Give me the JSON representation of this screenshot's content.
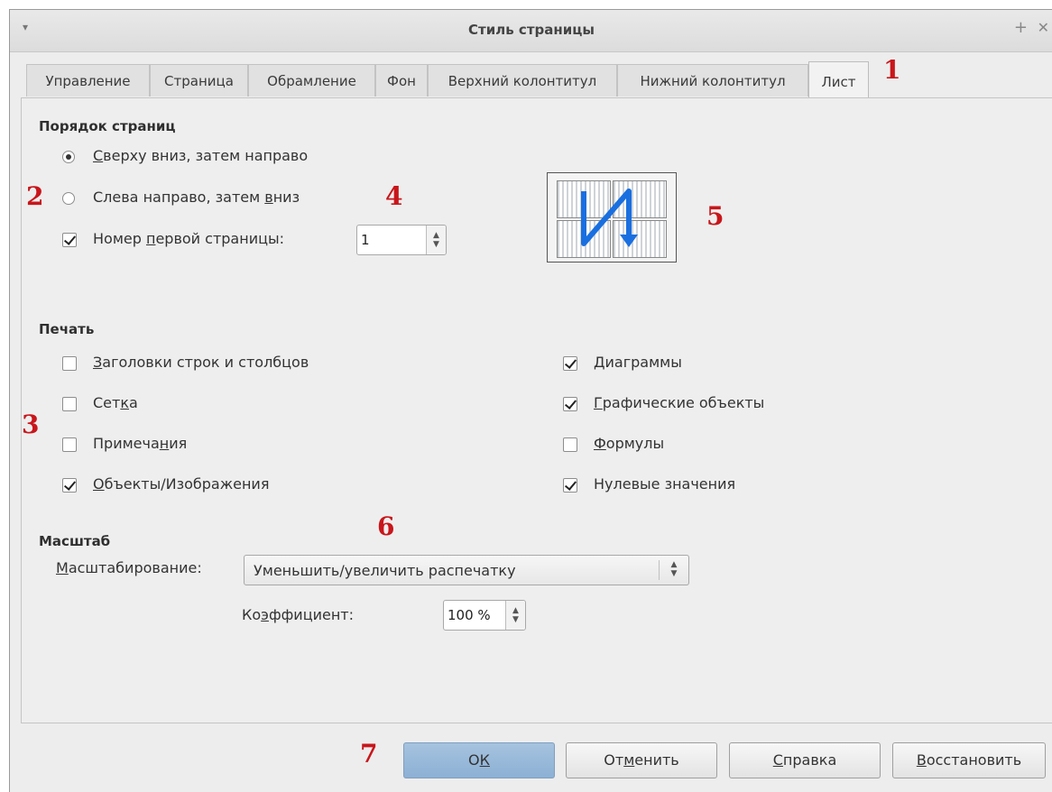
{
  "window": {
    "title": "Стиль страницы",
    "menu_glyph": "▾",
    "plus_glyph": "+",
    "close_glyph": "✕"
  },
  "tabs": [
    {
      "label": "Управление"
    },
    {
      "label": "Страница"
    },
    {
      "label": "Обрамление"
    },
    {
      "label": "Фон"
    },
    {
      "label": "Верхний колонтитул"
    },
    {
      "label": "Нижний колонтитул"
    },
    {
      "label": "Лист"
    }
  ],
  "active_tab": "Лист",
  "page_order": {
    "heading": "Порядок страниц",
    "option1": {
      "pre": "",
      "u": "С",
      "post": "верху вниз, затем направо",
      "selected": true
    },
    "option2": {
      "pre": "Слева направо, затем ",
      "u": "в",
      "post": "низ",
      "selected": false
    },
    "first_page": {
      "pre": "Номер ",
      "u": "п",
      "post": "ервой страницы:",
      "checked": true,
      "value": "1"
    }
  },
  "print": {
    "heading": "Печать",
    "items": [
      {
        "pre": "",
        "u": "З",
        "post": "аголовки строк и столбцов",
        "checked": false
      },
      {
        "pre": "Сет",
        "u": "к",
        "post": "а",
        "checked": false
      },
      {
        "pre": "Примеча",
        "u": "н",
        "post": "ия",
        "checked": false
      },
      {
        "pre": "",
        "u": "О",
        "post": "бъекты/Изображения",
        "checked": true
      },
      {
        "pre": "",
        "u": "Д",
        "post": "иаграммы",
        "checked": true
      },
      {
        "pre": "",
        "u": "Г",
        "post": "рафические объекты",
        "checked": true
      },
      {
        "pre": "",
        "u": "Ф",
        "post": "ормулы",
        "checked": false
      },
      {
        "pre": "Нулевые значения",
        "u": "",
        "post": "",
        "checked": true
      }
    ]
  },
  "scale": {
    "heading": "Масштаб",
    "mode_label": {
      "pre": "",
      "u": "М",
      "post": "асштабирование:"
    },
    "mode_value": "Уменьшить/увеличить распечатку",
    "factor_label": {
      "pre": "Ко",
      "u": "э",
      "post": "ффициент:"
    },
    "factor_value": "100 %"
  },
  "annotations": [
    "1",
    "2",
    "3",
    "4",
    "5",
    "6",
    "7"
  ],
  "buttons": {
    "ok": {
      "pre": "О",
      "u": "К",
      "post": ""
    },
    "cancel": {
      "pre": "От",
      "u": "м",
      "post": "енить"
    },
    "help": {
      "pre": "",
      "u": "С",
      "post": "правка"
    },
    "reset": {
      "pre": "",
      "u": "В",
      "post": "осстановить"
    }
  },
  "colors": {
    "annotation": "#c8161b",
    "preview_arrow": "#1a6fe0",
    "ok_button": "#9ab9d9"
  }
}
